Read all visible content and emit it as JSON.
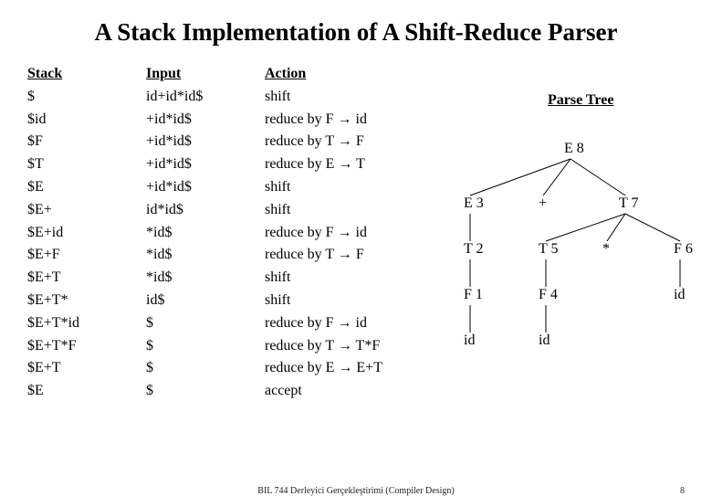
{
  "title": "A Stack Implementation of A Shift-Reduce Parser",
  "headers": {
    "stack": "Stack",
    "input": "Input",
    "action": "Action"
  },
  "rows": [
    {
      "stack": "$",
      "input": "id+id*id$",
      "action": "shift"
    },
    {
      "stack": "$id",
      "input": "+id*id$",
      "action": "reduce by F → id"
    },
    {
      "stack": "$F",
      "input": "+id*id$",
      "action": "reduce by T → F"
    },
    {
      "stack": "$T",
      "input": "+id*id$",
      "action": "reduce by E → T"
    },
    {
      "stack": "$E",
      "input": "+id*id$",
      "action": "shift"
    },
    {
      "stack": "$E+",
      "input": "id*id$",
      "action": "shift"
    },
    {
      "stack": "$E+id",
      "input": "*id$",
      "action": "reduce by F → id"
    },
    {
      "stack": "$E+F",
      "input": "*id$",
      "action": "reduce by T → F"
    },
    {
      "stack": "$E+T",
      "input": "*id$",
      "action": "shift"
    },
    {
      "stack": "$E+T*",
      "input": "id$",
      "action": "shift"
    },
    {
      "stack": "$E+T*id",
      "input": "$",
      "action": "reduce by F → id"
    },
    {
      "stack": "$E+T*F",
      "input": "$",
      "action": "reduce by T → T*F"
    },
    {
      "stack": "$E+T",
      "input": "$",
      "action": "reduce by E → E+T"
    },
    {
      "stack": "$E",
      "input": "$",
      "action": "accept"
    }
  ],
  "tree": {
    "title": "Parse Tree",
    "nodes": {
      "root": "E  8",
      "l": "E  3",
      "m": "+",
      "r": "T  7",
      "ll": "T  2",
      "rl": "T  5",
      "rm": "*",
      "rr": "F 6",
      "lll": "F  1",
      "rll": "F  4",
      "rrl": "id",
      "llll": "id",
      "rlll": "id"
    }
  },
  "footer": {
    "text": "BIL 744 Derleyici Gerçekleştirimi (Compiler Design)",
    "page": "8"
  }
}
